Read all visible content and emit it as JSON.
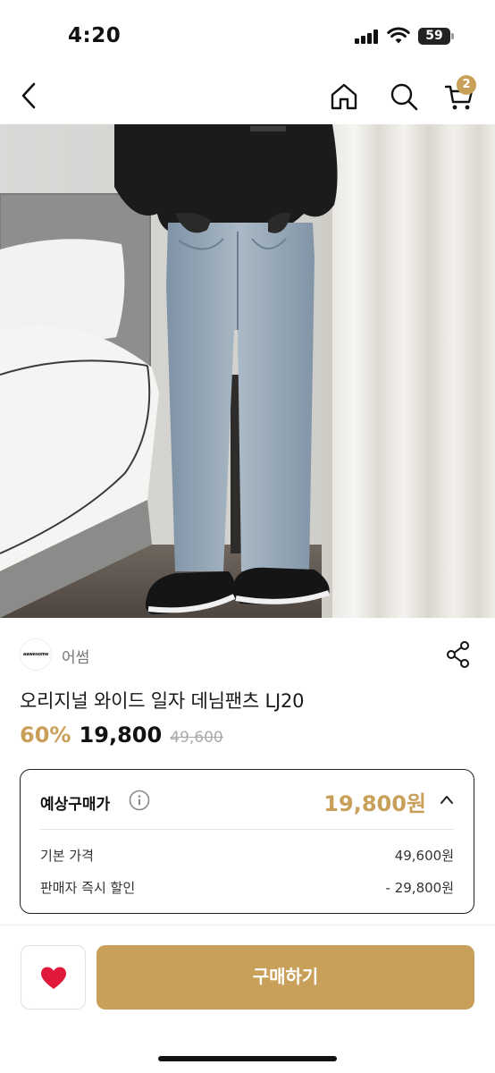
{
  "status_bar": {
    "time": "4:20",
    "battery_level": "59"
  },
  "nav": {
    "back_icon": "chevron-left-icon",
    "home_icon": "home-icon",
    "search_icon": "search-icon",
    "cart_icon": "cart-icon",
    "cart_count": "2"
  },
  "product": {
    "image_icon": "product-photo",
    "seller_logo_text": "aawesome",
    "seller_name": "어썸",
    "title": "오리지널 와이드 일자 데님팬츠 LJ20",
    "discount_rate": "60%",
    "sale_price": "19,800",
    "original_price": "49,600"
  },
  "estimate": {
    "label": "예상구매가",
    "price": "19,800원",
    "base_price_label": "기본 가격",
    "base_price_value": "49,600원",
    "seller_discount_label": "판매자 즉시 할인",
    "seller_discount_value": "- 29,800원"
  },
  "actions": {
    "buy_label": "구매하기",
    "wish_icon": "heart-icon"
  },
  "colors": {
    "accent": "#c9a05a",
    "heart": "#e0193a"
  }
}
